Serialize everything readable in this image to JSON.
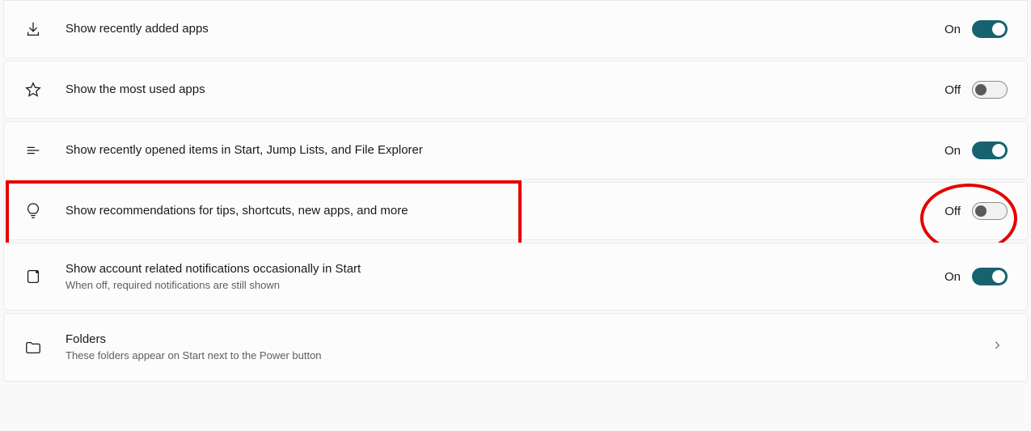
{
  "rows": [
    {
      "id": "recently-added",
      "icon": "download-icon",
      "label": "Show recently added apps",
      "state": "On",
      "toggle": "on"
    },
    {
      "id": "most-used",
      "icon": "star-icon",
      "label": "Show the most used apps",
      "state": "Off",
      "toggle": "off"
    },
    {
      "id": "recently-opened",
      "icon": "lines-icon",
      "label": "Show recently opened items in Start, Jump Lists, and File Explorer",
      "state": "On",
      "toggle": "on"
    },
    {
      "id": "recommendations",
      "icon": "lightbulb-icon",
      "label": "Show recommendations for tips, shortcuts, new apps, and more",
      "state": "Off",
      "toggle": "off",
      "highlighted": true
    },
    {
      "id": "account-notifications",
      "icon": "tablet-icon",
      "label": "Show account related notifications occasionally in Start",
      "sublabel": "When off, required notifications are still shown",
      "state": "On",
      "toggle": "on"
    },
    {
      "id": "folders",
      "icon": "folder-icon",
      "label": "Folders",
      "sublabel": "These folders appear on Start next to the Power button",
      "chevron": true
    }
  ]
}
